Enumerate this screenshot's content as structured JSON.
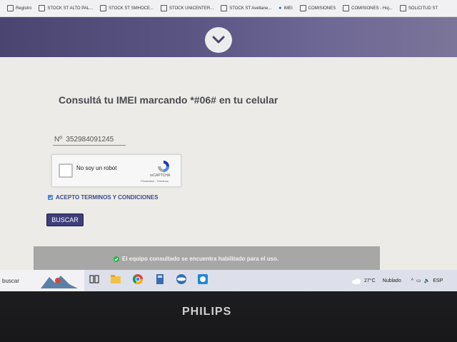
{
  "bookmarks": [
    {
      "label": "Registro",
      "icon": "page-icon"
    },
    {
      "label": "STOCK ST ALTO PAL...",
      "icon": "page-icon"
    },
    {
      "label": "STOCK ST SMHOCE...",
      "icon": "page-icon"
    },
    {
      "label": "STOCK UNICENTER...",
      "icon": "page-icon"
    },
    {
      "label": "STOCK ST Avellane...",
      "icon": "page-icon"
    },
    {
      "label": "IMEI",
      "icon": "drop-icon"
    },
    {
      "label": "COMISIONES",
      "icon": "page-icon"
    },
    {
      "label": "COMISIONES - Hoj...",
      "icon": "page-icon"
    },
    {
      "label": "SOLICITUD ST",
      "icon": "page-icon"
    }
  ],
  "page": {
    "title": "Consultá tu IMEI marcando *#06# en tu celular",
    "imei_value": "Nº  352984091245",
    "captcha": {
      "label": "No soy un robot",
      "brand": "reCAPTCHA",
      "links": "Privacidad - Términos"
    },
    "terms_label": "ACEPTO TERMINOS Y CONDICIONES",
    "button_label": "BUSCAR",
    "result_message": "El equipo consultado se encuentra habilitado para el uso.",
    "colors": {
      "hero": "#5a5483",
      "button": "#3e3e7a",
      "success": "#2ab34a"
    }
  },
  "taskbar": {
    "search_text": "buscar",
    "apps": [
      "task-view-icon",
      "file-explorer-icon",
      "chrome-icon",
      "calculator-icon",
      "app-icon",
      "app-icon"
    ],
    "weather": "27°C",
    "weather_desc": "Nublado",
    "language": "ESP"
  },
  "monitor": {
    "brand": "PHILIPS"
  }
}
